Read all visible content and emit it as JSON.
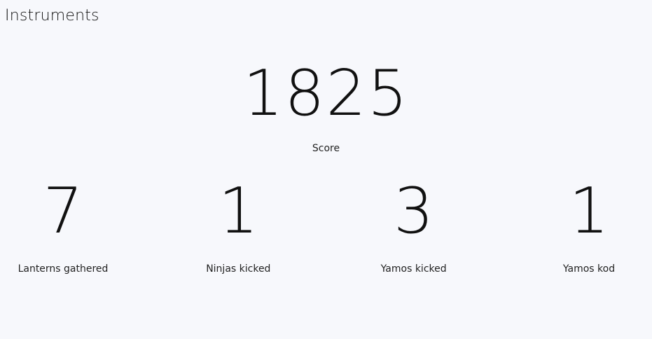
{
  "header": {
    "title": "Instruments"
  },
  "score": {
    "value": "1825",
    "label": "Score"
  },
  "stats": [
    {
      "value": "7",
      "label": "Lanterns gathered"
    },
    {
      "value": "1",
      "label": "Ninjas kicked"
    },
    {
      "value": "3",
      "label": "Yamos kicked"
    },
    {
      "value": "1",
      "label": "Yamos kod"
    }
  ],
  "colors": {
    "background": "#f7f8fc",
    "text": "#111111"
  }
}
